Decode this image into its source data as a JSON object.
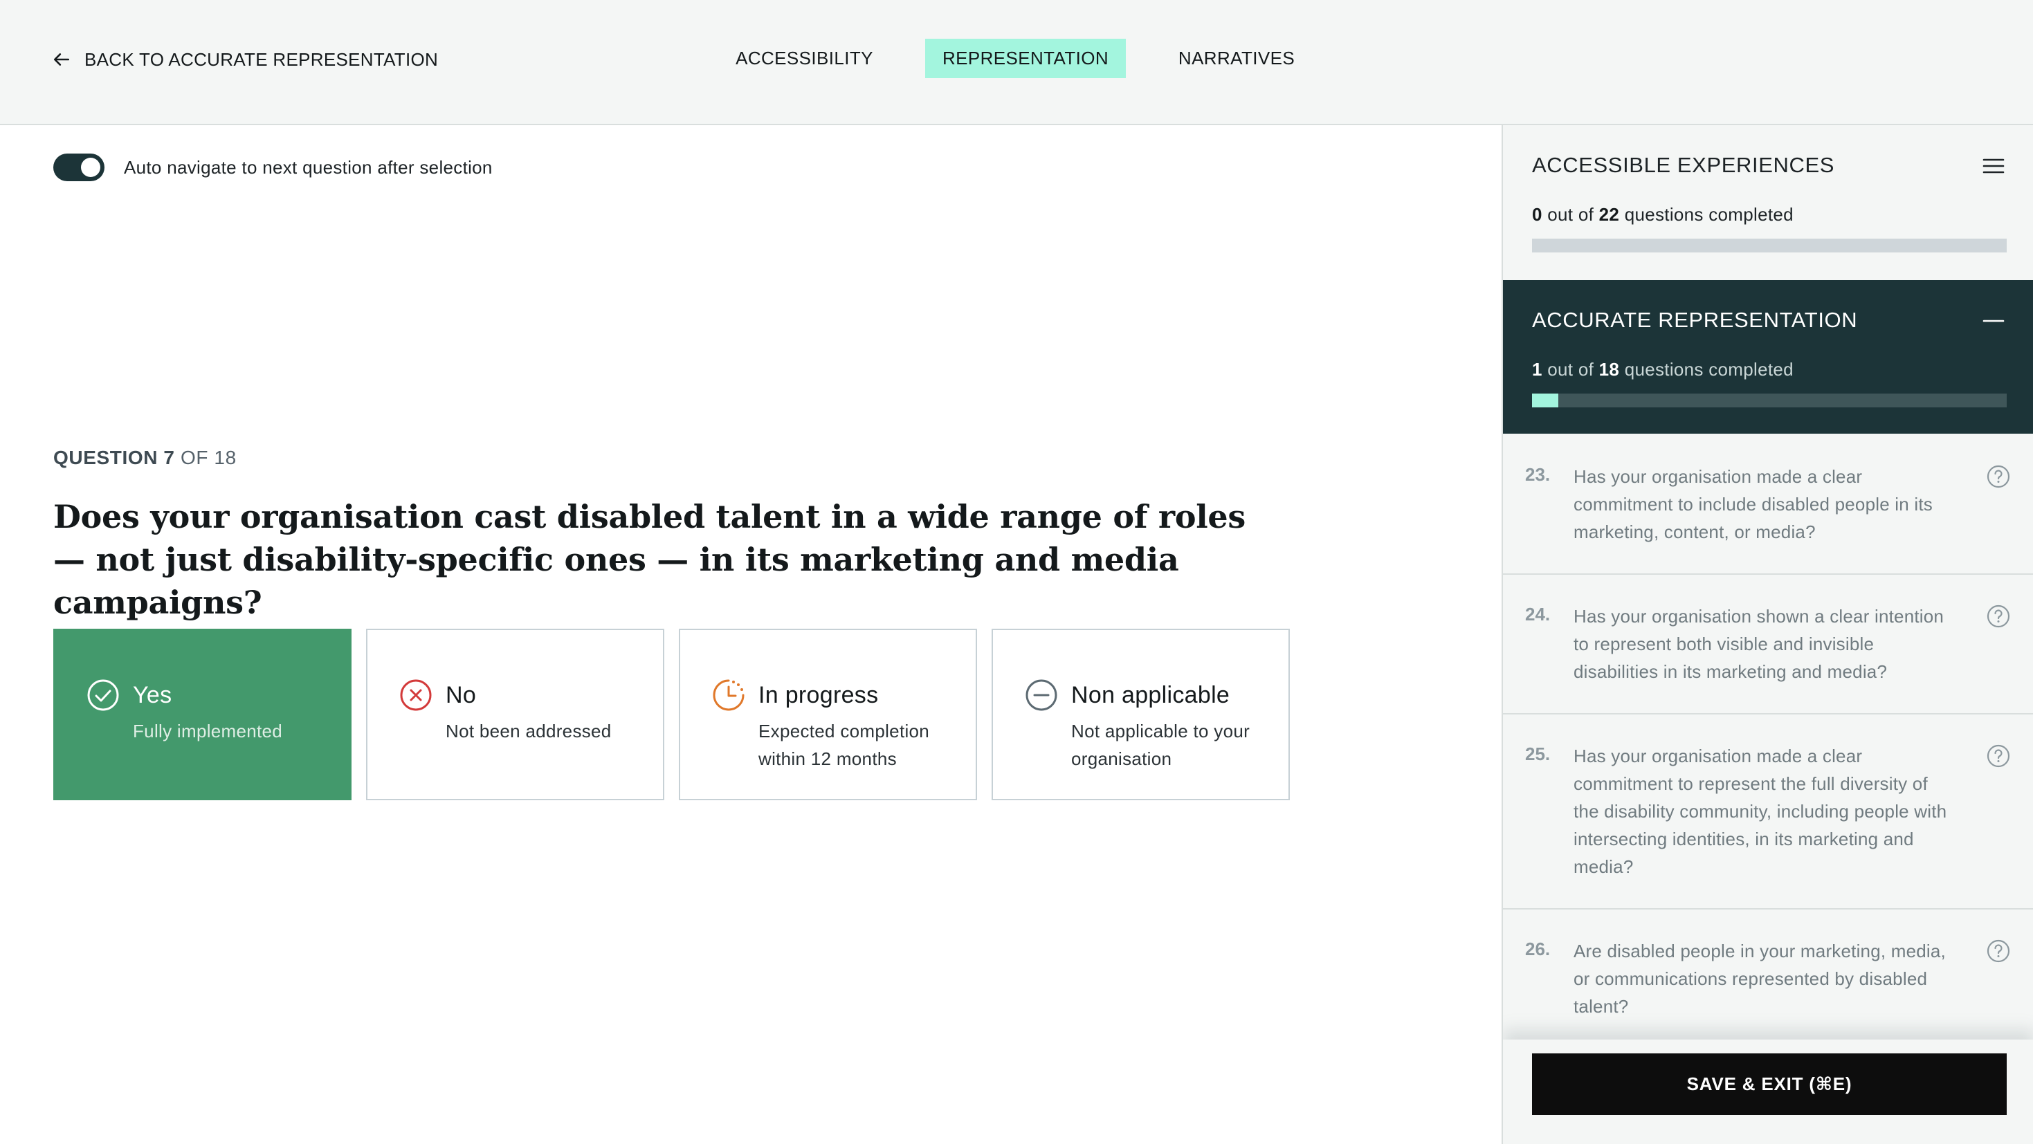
{
  "header": {
    "back_label": "BACK TO ACCURATE REPRESENTATION",
    "tabs": [
      {
        "label": "ACCESSIBILITY",
        "active": false
      },
      {
        "label": "REPRESENTATION",
        "active": true
      },
      {
        "label": "NARRATIVES",
        "active": false
      }
    ]
  },
  "toggle": {
    "label": "Auto navigate to next question after selection",
    "on": true
  },
  "question": {
    "counter_prefix": "QUESTION 7",
    "counter_suffix": " OF 18",
    "text": "Does your organisation cast disabled talent in a wide range of roles — not just disability-specific ones — in its marketing and media campaigns?"
  },
  "options": [
    {
      "label": "Yes",
      "sub": "Fully implemented",
      "icon": "check-circle-icon",
      "selected": true
    },
    {
      "label": "No",
      "sub": "Not been addressed",
      "icon": "x-circle-icon",
      "selected": false
    },
    {
      "label": "In progress",
      "sub": "Expected completion within 12 months",
      "icon": "clock-progress-icon",
      "selected": false
    },
    {
      "label": "Non applicable",
      "sub": "Not applicable to your organisation",
      "icon": "minus-circle-icon",
      "selected": false
    }
  ],
  "colors": {
    "selected_green": "#43996c",
    "no_red": "#d33a3a",
    "progress_orange": "#e0782a",
    "na_grey": "#5c6a72",
    "tab_highlight": "#a3f5de",
    "dark_teal": "#1c3438"
  },
  "sidebar": {
    "sections": [
      {
        "title": "ACCESSIBLE EXPERIENCES",
        "done": "0",
        "mid": " out of ",
        "total": "22",
        "tail": " questions completed",
        "progress": 0.0,
        "icon": "menu-icon"
      },
      {
        "title": "ACCURATE REPRESENTATION",
        "done": "1",
        "mid": " out of ",
        "total": "18",
        "tail": " questions completed",
        "progress": 0.0556,
        "icon": "minus-icon"
      }
    ],
    "questions": [
      {
        "num": "23.",
        "text": "Has your organisation made a clear commitment to include disabled people in its marketing, content, or media?"
      },
      {
        "num": "24.",
        "text": "Has your organisation shown a clear intention to represent both visible and invisible disabilities in its marketing and media?"
      },
      {
        "num": "25.",
        "text": "Has your organisation made a clear commitment to represent the full diversity of the disability community, including people with intersecting identities, in its marketing and media?"
      },
      {
        "num": "26.",
        "text": "Are disabled people in your marketing, media, or communications represented by disabled talent?"
      }
    ],
    "save_label": "SAVE & EXIT  (⌘E)"
  }
}
